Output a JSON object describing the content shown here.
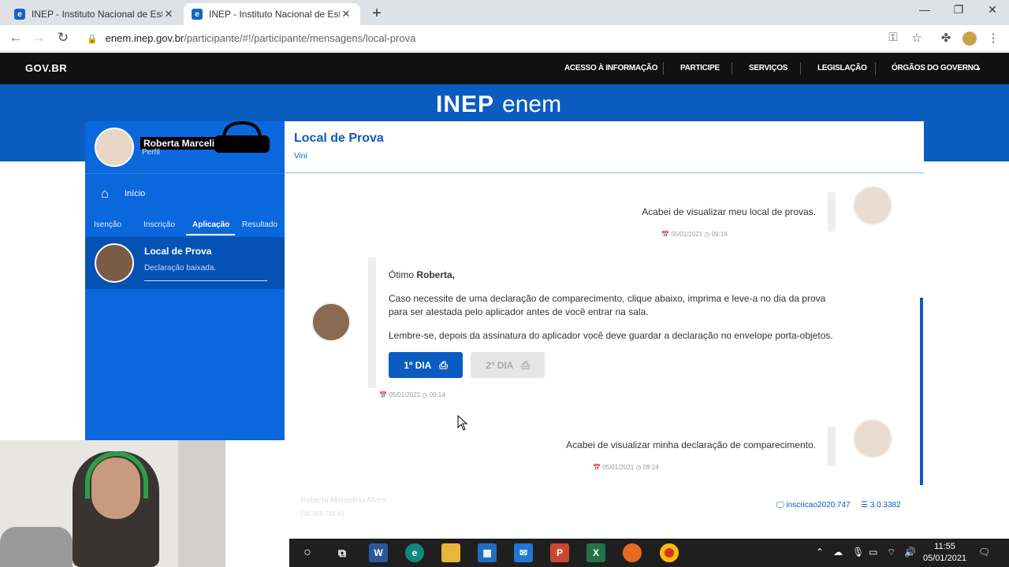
{
  "browser": {
    "tabs": [
      {
        "title": "INEP - Instituto Nacional de Estu",
        "active": false
      },
      {
        "title": "INEP - Instituto Nacional de Estu",
        "active": true
      }
    ],
    "url_host": "enem.inep.gov.br",
    "url_path": "/participante/#!/participante/mensagens/local-prova"
  },
  "govbar": {
    "logo": "GOV.BR",
    "nav": [
      "ACESSO À INFORMAÇÃO",
      "PARTICIPE",
      "SERVIÇOS",
      "LEGISLAÇÃO",
      "ÓRGÃOS DO GOVERNO"
    ]
  },
  "header": {
    "logo_inep": "INEP",
    "logo_enem": "enem"
  },
  "sidebar": {
    "profile_name": "Roberta Marcelino Alves",
    "profile_role": "Perfil",
    "home_label": "Início",
    "tabs": [
      "Isenção",
      "Inscrição",
      "Aplicação",
      "Resultado"
    ],
    "active_tab": "Aplicação",
    "item": {
      "title": "Local de Prova",
      "subtitle": "Declaração baixada."
    }
  },
  "main": {
    "title": "Local de Prova",
    "subtitle": "Vini",
    "messages": {
      "user1": {
        "text": "Acabei de visualizar meu local de provas.",
        "date": "05/01/2021",
        "time": "09:14"
      },
      "bot": {
        "greeting_prefix": "Ótimo ",
        "greeting_name": "Roberta,",
        "p1": "Caso necessite de uma declaração de comparecimento, clique abaixo, imprima e leve-a no dia da prova para ser atestada pelo aplicador antes de você entrar na sala.",
        "p2": "Lembre-se, depois da assinatura do aplicador você deve guardar a declaração no envelope porta-objetos.",
        "btn1": "1º DIA",
        "btn2": "2º DIA",
        "date": "05/01/2021",
        "time": "09:14"
      },
      "user2": {
        "text": "Acabei de visualizar minha declaração de comparecimento.",
        "date": "05/01/2021",
        "time": "09:14"
      }
    },
    "footer": {
      "name": "Roberta Marcelino Alves",
      "id": "100.059.733-41",
      "inscricao": "inscricao2020.747",
      "version": "3.0.3382"
    }
  },
  "taskbar": {
    "time": "11:55",
    "date": "05/01/2021"
  }
}
